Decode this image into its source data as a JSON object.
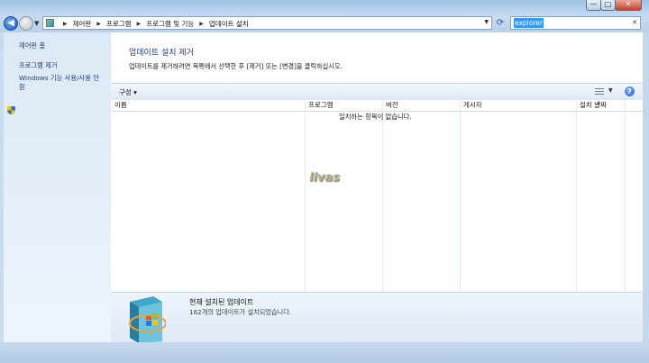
{
  "window": {
    "controls": {
      "minimize": "—",
      "maximize": "□",
      "close": "✕"
    }
  },
  "address": {
    "crumbs": [
      "제어판",
      "프로그램",
      "프로그램 및 기능",
      "업데이트 설치"
    ],
    "search_value": "explorer"
  },
  "sidebar": {
    "items": [
      {
        "label": "제어판 홈"
      },
      {
        "label": "프로그램 제거"
      },
      {
        "label": "Windows 기능 사용/사용 안",
        "label2": "함",
        "icon": "shield-icon"
      }
    ]
  },
  "main": {
    "title": "업데이트 설치 제거",
    "description": "업데이트를 제거하려면 목록에서 선택한 후 [제거] 또는 [변경]을 클릭하십시오.",
    "toolbar": {
      "organize_label": "구성 ▾"
    },
    "columns": [
      "이름",
      "프로그램",
      "버전",
      "게시자",
      "설치 날짜"
    ],
    "empty_message": "일치하는 항목이 없습니다.",
    "watermark": "livas"
  },
  "details": {
    "title": "현재 설치된 업데이트",
    "subtitle": "162개의 업데이트가 설치되었습니다."
  },
  "colors": {
    "accent": "#1e3d8f",
    "link": "#1b3f78",
    "chrome": "#c9dcee"
  }
}
